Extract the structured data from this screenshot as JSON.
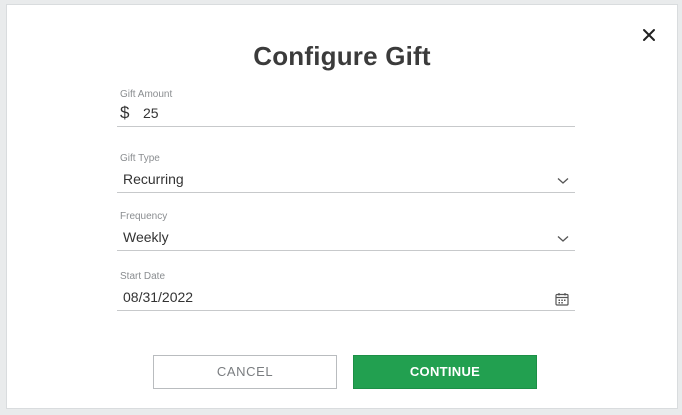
{
  "dialog": {
    "title": "Configure Gift",
    "close_icon": "close-icon"
  },
  "fields": {
    "amount": {
      "label": "Gift Amount",
      "prefix": "$",
      "value": "25"
    },
    "type": {
      "label": "Gift Type",
      "value": "Recurring",
      "icon": "chevron-down-icon"
    },
    "frequency": {
      "label": "Frequency",
      "value": "Weekly",
      "icon": "chevron-down-icon"
    },
    "start_date": {
      "label": "Start Date",
      "value": "08/31/2022",
      "icon": "calendar-icon"
    }
  },
  "buttons": {
    "cancel": "CANCEL",
    "continue": "CONTINUE"
  },
  "colors": {
    "primary": "#22a050",
    "title": "#3b3b3b",
    "label": "#8a8d90"
  }
}
